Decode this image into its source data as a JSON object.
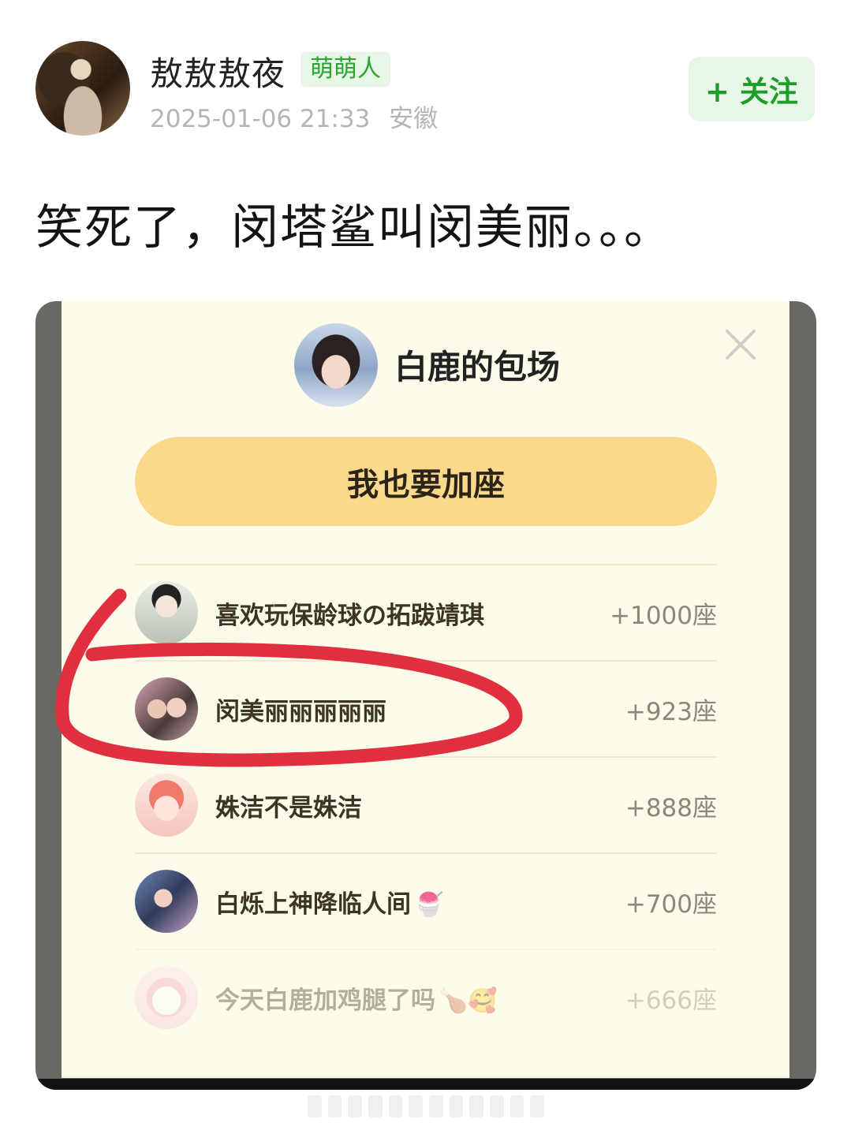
{
  "post": {
    "author": "敖敖敖夜",
    "badge": "萌萌人",
    "date": "2025-01-06 21:33",
    "location": "安徽",
    "follow_label": "+ 关注",
    "text": "笑死了，闵塔鲨叫闵美丽。。。"
  },
  "embedded": {
    "title": "白鹿的包场",
    "cta_label": "我也要加座",
    "list": [
      {
        "name": "喜欢玩保龄球の拓跋靖琪",
        "seats": "+1000座",
        "emoji": ""
      },
      {
        "name": "闵美丽丽丽丽丽",
        "seats": "+923座",
        "emoji": ""
      },
      {
        "name": "姝洁不是姝洁",
        "seats": "+888座",
        "emoji": ""
      },
      {
        "name": "白烁上神降临人间",
        "seats": "+700座",
        "emoji": "🍧"
      },
      {
        "name": "今天白鹿加鸡腿了吗",
        "seats": "+666座",
        "emoji": "🍗🥰"
      }
    ]
  },
  "colors": {
    "accent_green": "#1f9d2a",
    "cta_yellow": "#fbd98a",
    "annotation_red": "#e0303f"
  }
}
